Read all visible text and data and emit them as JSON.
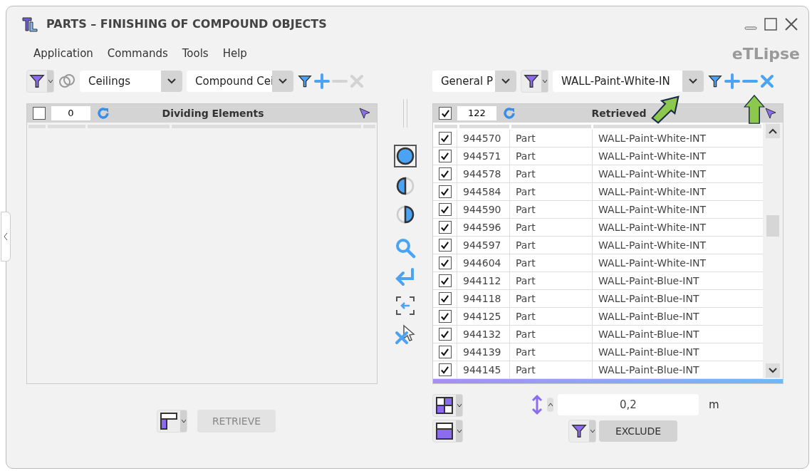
{
  "window": {
    "title": "PARTS – FINISHING OF COMPOUND OBJECTS",
    "logo": "eTLipse"
  },
  "menu": [
    "Application",
    "Commands",
    "Tools",
    "Help"
  ],
  "left": {
    "category": "Ceilings",
    "type": "Compound Cei",
    "header": {
      "checked": false,
      "count": "0",
      "title": "Dividing Elements"
    },
    "retrieve": {
      "label": "RETRIEVE",
      "disabled": true
    }
  },
  "right": {
    "category": "General P",
    "filter": "WALL-Paint-White-IN",
    "header": {
      "checked": true,
      "count": "122",
      "title": "Retrieved"
    },
    "rows": [
      {
        "checked": true,
        "id": "944570",
        "type": "Part",
        "name": "WALL-Paint-White-INT"
      },
      {
        "checked": true,
        "id": "944571",
        "type": "Part",
        "name": "WALL-Paint-White-INT"
      },
      {
        "checked": true,
        "id": "944578",
        "type": "Part",
        "name": "WALL-Paint-White-INT"
      },
      {
        "checked": true,
        "id": "944584",
        "type": "Part",
        "name": "WALL-Paint-White-INT"
      },
      {
        "checked": true,
        "id": "944590",
        "type": "Part",
        "name": "WALL-Paint-White-INT"
      },
      {
        "checked": true,
        "id": "944596",
        "type": "Part",
        "name": "WALL-Paint-White-INT"
      },
      {
        "checked": true,
        "id": "944597",
        "type": "Part",
        "name": "WALL-Paint-White-INT"
      },
      {
        "checked": true,
        "id": "944604",
        "type": "Part",
        "name": "WALL-Paint-White-INT"
      },
      {
        "checked": true,
        "id": "944112",
        "type": "Part",
        "name": "WALL-Paint-Blue-INT"
      },
      {
        "checked": true,
        "id": "944118",
        "type": "Part",
        "name": "WALL-Paint-Blue-INT"
      },
      {
        "checked": true,
        "id": "944125",
        "type": "Part",
        "name": "WALL-Paint-Blue-INT"
      },
      {
        "checked": true,
        "id": "944132",
        "type": "Part",
        "name": "WALL-Paint-Blue-INT"
      },
      {
        "checked": true,
        "id": "944139",
        "type": "Part",
        "name": "WALL-Paint-Blue-INT"
      },
      {
        "checked": true,
        "id": "944145",
        "type": "Part",
        "name": "WALL-Paint-Blue-INT"
      }
    ],
    "distance": {
      "value": "0,2",
      "unit": "m"
    },
    "exclude": {
      "label": "EXCLUDE",
      "disabled": false
    }
  }
}
